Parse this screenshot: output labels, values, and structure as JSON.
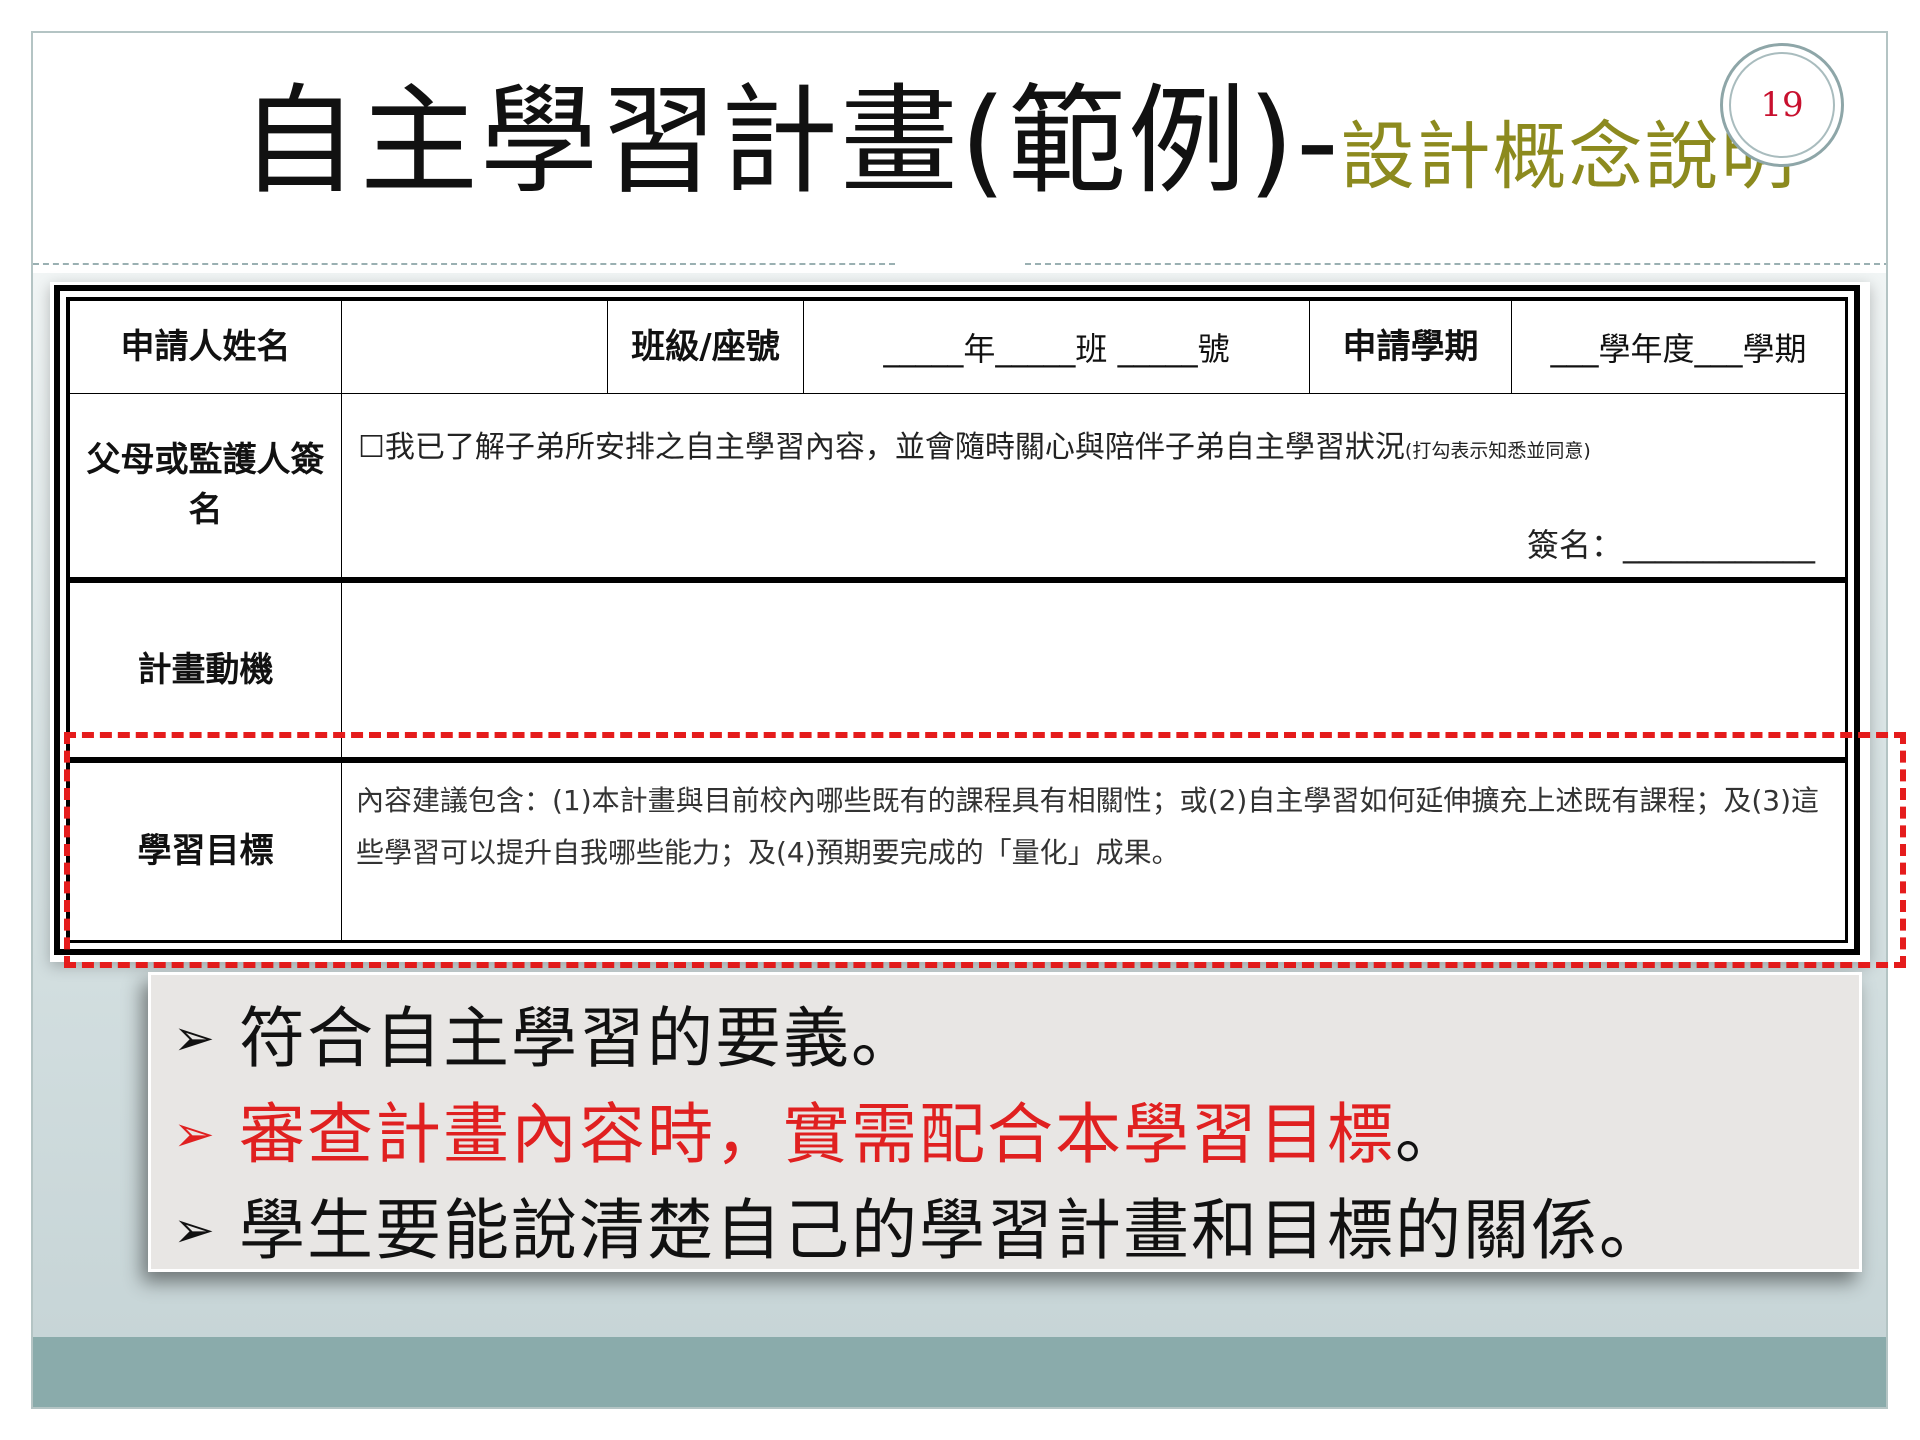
{
  "slide": {
    "title_main": "自主學習計畫(範例)-",
    "title_sub": "設計概念說明",
    "page_number": "19"
  },
  "form": {
    "row1": {
      "name_label": "申請人姓名",
      "class_label": "班級/座號",
      "class_blank": "_____年_____班 _____號",
      "term_label": "申請學期",
      "term_blank": "___學年度___學期"
    },
    "row2": {
      "label": "父母或監護人簽名",
      "checkbox": "☐",
      "consent_text": "我已了解子弟所安排之自主學習內容，並會隨時關心與陪伴子弟自主學習狀況",
      "consent_note": "(打勾表示知悉並同意)",
      "sign_text": "簽名：____________"
    },
    "row3": {
      "label": "計畫動機"
    },
    "row4": {
      "label": "學習目標",
      "content": "內容建議包含：(1)本計畫與目前校內哪些既有的課程具有相關性；或(2)自主學習如何延伸擴充上述既有課程；及(3)這些學習可以提升自我哪些能力；及(4)預期要完成的「量化」成果。"
    }
  },
  "bullets": [
    {
      "arrow": "➢",
      "text": "符合自主學習的要義。",
      "tail": ""
    },
    {
      "arrow": "➢",
      "text": "審查計畫內容時，實需配合本學習目標",
      "tail": "。"
    },
    {
      "arrow": "➢",
      "text": "學生要能說清楚自己的學習計畫和目標的關係。",
      "tail": ""
    }
  ],
  "colors": {
    "title_sub": "#8c8a1e",
    "page_number": "#c8102e",
    "highlight_box": "#e51c1c",
    "emphasis_text": "#e02020",
    "footer_band": "#8aabab"
  }
}
